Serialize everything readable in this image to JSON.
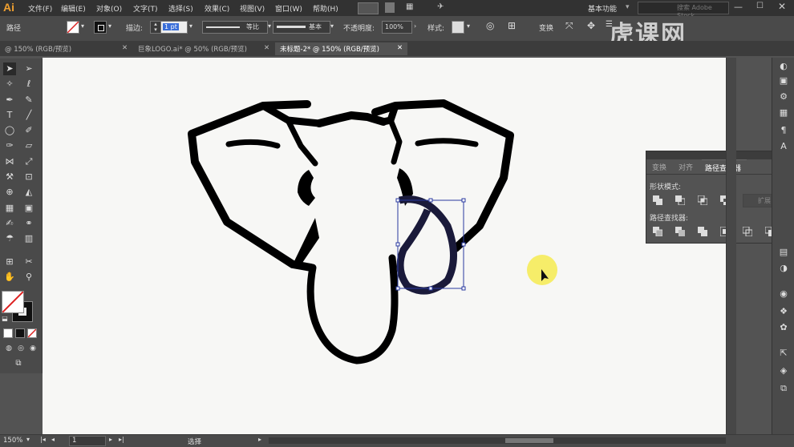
{
  "app": {
    "logo": "Ai",
    "workspace": "基本功能",
    "search_placeholder": "搜索 Adobe Stock"
  },
  "menu": [
    "文件(F)",
    "编辑(E)",
    "对象(O)",
    "文字(T)",
    "选择(S)",
    "效果(C)",
    "视图(V)",
    "窗口(W)",
    "帮助(H)"
  ],
  "control": {
    "path_label": "路径",
    "stroke_label": "描边:",
    "stroke_value": "1 pt",
    "profile_label": "等比",
    "brush_label": "基本",
    "opacity_label": "不透明度:",
    "opacity_value": "100%",
    "style_label": "样式:",
    "transform_label": "变换"
  },
  "tabs": [
    "@ 150% (RGB/预览)",
    "巨象LOGO.ai* @ 50% (RGB/预览)",
    "未标题-2* @ 150% (RGB/预览)"
  ],
  "active_tab": 2,
  "panel": {
    "tabs": [
      "变换",
      "对齐",
      "路径查找器"
    ],
    "shape_modes_label": "形状模式:",
    "expand_button": "扩展",
    "pathfinders_label": "路径查找器:"
  },
  "status": {
    "zoom": "150%",
    "artboard": "1",
    "mode": "选择"
  },
  "watermark": "虎课网",
  "colors": {
    "accent": "#f0a030",
    "selection": "#2a3aa0",
    "cursor_highlight": "#f5eb5a"
  }
}
